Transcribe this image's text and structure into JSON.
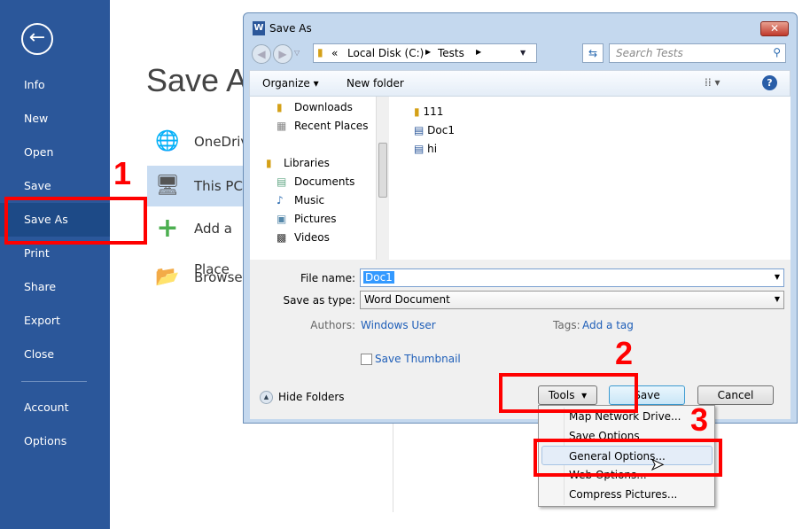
{
  "sidebar": {
    "items": [
      "Info",
      "New",
      "Open",
      "Save",
      "Save As",
      "Print",
      "Share",
      "Export",
      "Close",
      "Account",
      "Options"
    ],
    "selected": "Save As",
    "color": "#2b579a"
  },
  "main": {
    "title": "Save As",
    "locations": [
      "OneDrive",
      "This PC",
      "Add a Place",
      "Browse"
    ],
    "selected": "This PC"
  },
  "annotations": [
    "1",
    "2",
    "3"
  ],
  "dialog": {
    "title": "Save As",
    "address": {
      "prefix": "«",
      "parts": [
        "Local Disk (C:)",
        "Tests"
      ]
    },
    "search_placeholder": "Search Tests",
    "toolbar": {
      "organize": "Organize",
      "new_folder": "New folder"
    },
    "nav": [
      {
        "label": "Downloads",
        "icon": "folder-download-icon"
      },
      {
        "label": "Recent Places",
        "icon": "recent-places-icon"
      },
      {
        "label": "Libraries",
        "icon": "libraries-icon"
      },
      {
        "label": "Documents",
        "icon": "documents-icon"
      },
      {
        "label": "Music",
        "icon": "music-icon"
      },
      {
        "label": "Pictures",
        "icon": "pictures-icon"
      },
      {
        "label": "Videos",
        "icon": "videos-icon"
      }
    ],
    "files": [
      {
        "name": "111",
        "icon": "folder-icon"
      },
      {
        "name": "Doc1",
        "icon": "word-doc-icon"
      },
      {
        "name": "hi",
        "icon": "word-doc-icon"
      }
    ],
    "file_name_label": "File name:",
    "file_name": "Doc1",
    "save_type_label": "Save as type:",
    "save_type": "Word Document",
    "authors_label": "Authors:",
    "authors": "Windows User",
    "tags_label": "Tags:",
    "tags": "Add a tag",
    "thumbnail": "Save Thumbnail",
    "hide_folders": "Hide Folders",
    "tools": "Tools",
    "save": "Save",
    "cancel": "Cancel",
    "menu": [
      "Map Network Drive...",
      "Save Options",
      "General Options...",
      "Web Options...",
      "Compress Pictures..."
    ],
    "menu_highlighted": "General Options..."
  }
}
